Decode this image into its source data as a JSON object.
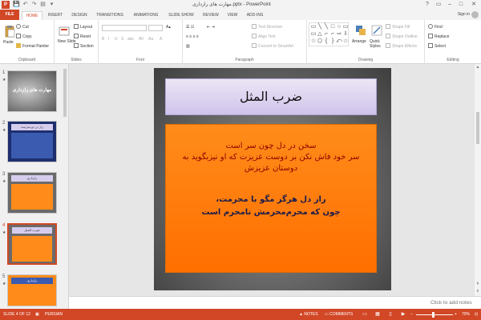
{
  "app": {
    "icon_letter": "P",
    "title": "مهارت های رازداری.pptx - PowerPoint",
    "quick_access": [
      "💾",
      "↶",
      "↷",
      "▤",
      "▾"
    ],
    "window_controls": [
      "?",
      "▭",
      "–",
      "□",
      "✕"
    ]
  },
  "tabs": [
    {
      "label": "FILE"
    },
    {
      "label": "HOME"
    },
    {
      "label": "INSERT"
    },
    {
      "label": "DESIGN"
    },
    {
      "label": "TRANSITIONS"
    },
    {
      "label": "ANIMATIONS"
    },
    {
      "label": "SLIDE SHOW"
    },
    {
      "label": "REVIEW"
    },
    {
      "label": "VIEW"
    },
    {
      "label": "ADD-INS"
    }
  ],
  "active_tab": "HOME",
  "signin": "Sign in",
  "ribbon": {
    "clipboard": {
      "paste": "Paste",
      "cut": "Cut",
      "copy": "Copy",
      "format_painter": "Format Painter",
      "label": "Clipboard"
    },
    "slides": {
      "new_slide": "New Slide",
      "layout": "Layout",
      "reset": "Reset",
      "section": "Section",
      "label": "Slides"
    },
    "font": {
      "label": "Font",
      "buttons": [
        "B",
        "I",
        "U",
        "S",
        "abc",
        "AV",
        "Aa",
        "A"
      ]
    },
    "paragraph": {
      "text_direction": "Text Direction",
      "align_text": "Align Text",
      "convert_smartart": "Convert to SmartArt",
      "label": "Paragraph"
    },
    "drawing": {
      "arrange": "Arrange",
      "quick_styles": "Quick Styles",
      "shape_fill": "Shape Fill",
      "shape_outline": "Shape Outline",
      "shape_effects": "Shape Effects",
      "label": "Drawing",
      "shapes": [
        "▭",
        "╲",
        "╲",
        "□",
        "○",
        "▭",
        "▭",
        "△",
        "⌐",
        "⌐",
        "⇨",
        "⇩",
        "☆",
        "⬠",
        "{",
        "}",
        "⤺",
        "☆",
        "⬡",
        "△",
        "⌒",
        "⬭",
        "⌓",
        "☆"
      ]
    },
    "editing": {
      "find": "Find",
      "replace": "Replace",
      "select": "Select",
      "label": "Editing"
    }
  },
  "thumbnails": [
    {
      "number": "1",
      "title": "مهارت های رازداری"
    },
    {
      "number": "2",
      "title": "راز در دو مدرسه"
    },
    {
      "number": "3",
      "title": "رازداری"
    },
    {
      "number": "4",
      "title": "ضرب المثل"
    },
    {
      "number": "5",
      "title": "رازداری"
    }
  ],
  "selected_slide": 4,
  "slide": {
    "title": "ضرب المثل",
    "line1": "سخن در دل چون سر است",
    "line2": "سر خود فاش نکن بر دوست عزیزت که او نیزبگوید به دوستان عزیزش",
    "line3": "راز دل هرگز مگو با محرمت،",
    "line4": "چون که محرم‌محرمش نامحرم است"
  },
  "notes_placeholder": "Click to add notes",
  "status": {
    "slide_indicator": "SLIDE 4 OF 12",
    "language": "PERSIAN",
    "notes": "NOTES",
    "comments": "COMMENTS",
    "zoom": "70%",
    "zoom_fraction": 0.46
  },
  "colors": {
    "accent": "#d24726",
    "title_box": "#d6cdee",
    "body_box": "#ff7f0e"
  }
}
